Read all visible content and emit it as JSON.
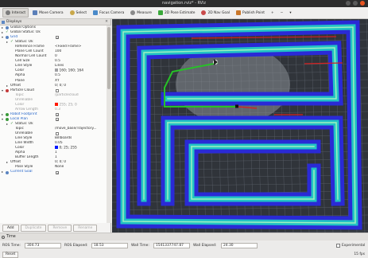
{
  "window": {
    "title": "navigation.rviz* - RViz"
  },
  "toolbar": {
    "tools": [
      {
        "label": "Interact",
        "icon": "interact-icon",
        "active": true
      },
      {
        "label": "Move Camera",
        "icon": "move-camera-icon",
        "active": false
      },
      {
        "label": "Select",
        "icon": "select-icon",
        "active": false
      },
      {
        "label": "Focus Camera",
        "icon": "focus-camera-icon",
        "active": false
      },
      {
        "label": "Measure",
        "icon": "measure-icon",
        "active": false
      },
      {
        "label": "2D Pose Estimate",
        "icon": "pose-estimate-icon",
        "active": false
      },
      {
        "label": "2D Nav Goal",
        "icon": "nav-goal-icon",
        "active": false
      },
      {
        "label": "Publish Point",
        "icon": "publish-point-icon",
        "active": false
      }
    ],
    "extra_plus": "+",
    "extra_minus": "−",
    "extra_arrow": "▾"
  },
  "displays": {
    "title": "Displays",
    "close": "✕",
    "rows": [
      {
        "key": "Global Options",
        "indent": 0,
        "arrow": "▸",
        "icon_color": "#5a84c0"
      },
      {
        "key": "Global Status: Ok",
        "indent": 0,
        "arrow": "▸",
        "check": "✓"
      },
      {
        "key": "Grid",
        "indent": 0,
        "arrow": "▾",
        "icon_color": "#5a84c0",
        "checkbox": "✓",
        "blue": true
      },
      {
        "key": "Status: Ok",
        "indent": 1,
        "arrow": "▸",
        "check": "✓"
      },
      {
        "key": "Reference Frame",
        "indent": 2,
        "value": "<Fixed Frame>"
      },
      {
        "key": "Plane Cell Count",
        "indent": 2,
        "value": "100"
      },
      {
        "key": "Normal Cell Count",
        "indent": 2,
        "value": "0"
      },
      {
        "key": "Cell Size",
        "indent": 2,
        "value": "0.5"
      },
      {
        "key": "Line Style",
        "indent": 2,
        "value": "Lines"
      },
      {
        "key": "Color",
        "indent": 2,
        "value": "160; 160; 164",
        "swatch": "#a0a0a4"
      },
      {
        "key": "Alpha",
        "indent": 2,
        "value": "0.5"
      },
      {
        "key": "Plane",
        "indent": 2,
        "value": "XY"
      },
      {
        "key": "Offset",
        "indent": 1,
        "arrow": "▸",
        "value": "0; 0; 0"
      },
      {
        "key": "Particle Cloud",
        "indent": 0,
        "arrow": "▾",
        "icon_color": "#c43a3a",
        "checkbox": ""
      },
      {
        "key": "Topic",
        "indent": 2,
        "value": "/particlecloud",
        "grey": true
      },
      {
        "key": "Unreliable",
        "indent": 2,
        "value": "",
        "grey": true
      },
      {
        "key": "Color",
        "indent": 2,
        "value": "255; 25; 0",
        "grey": true,
        "swatch": "#ff1900"
      },
      {
        "key": "Arrow Length",
        "indent": 2,
        "value": "0.3",
        "grey": true
      },
      {
        "key": "Robot Footprint",
        "indent": 0,
        "arrow": "▸",
        "icon_color": "#3a9a3a",
        "checkbox": "✓",
        "blue": true
      },
      {
        "key": "Local Plan",
        "indent": 0,
        "arrow": "▾",
        "icon_color": "#3a9a3a",
        "checkbox": "✓",
        "blue": true
      },
      {
        "key": "Status: Ok",
        "indent": 1,
        "arrow": "▸",
        "check": "✓"
      },
      {
        "key": "Topic",
        "indent": 2,
        "value": "/move_base/Trajectory..."
      },
      {
        "key": "Unreliable",
        "indent": 2,
        "value": "",
        "cbval": true
      },
      {
        "key": "Line Style",
        "indent": 2,
        "value": "Billboards"
      },
      {
        "key": "Line Width",
        "indent": 2,
        "value": "0.05"
      },
      {
        "key": "Color",
        "indent": 2,
        "value": "0; 25; 255",
        "swatch": "#0019ff"
      },
      {
        "key": "Alpha",
        "indent": 2,
        "value": "1"
      },
      {
        "key": "Buffer Length",
        "indent": 2,
        "value": "1"
      },
      {
        "key": "Offset",
        "indent": 1,
        "arrow": "▸",
        "value": "0; 0; 0"
      },
      {
        "key": "Pose Style",
        "indent": 2,
        "value": "None"
      },
      {
        "key": "Current Goal",
        "indent": 0,
        "arrow": "▸",
        "icon_color": "#5a84c0",
        "checkbox": "✓",
        "blue": true
      }
    ],
    "buttons": {
      "add": "Add",
      "duplicate": "Duplicate",
      "remove": "Remove",
      "rename": "Rename"
    }
  },
  "view": {
    "name": "3d-map-view",
    "colors": {
      "background": "#30343a",
      "grid": "#808894",
      "costmap_outer": "#2a2ad6",
      "costmap_inner": "#22c4c4",
      "wall": "#9ff0c0",
      "global_plan": "#27c227",
      "local_plan": "#d42020"
    }
  },
  "time": {
    "title": "Time",
    "ros_time_label": "ROS Time:",
    "ros_time": "304.73",
    "ros_elapsed_label": "ROS Elapsed:",
    "ros_elapsed": "18.53",
    "wall_time_label": "Wall Time:",
    "wall_time": "1541337747.87",
    "wall_elapsed_label": "Wall Elapsed:",
    "wall_elapsed": "24.30",
    "experimental_label": "Experimental"
  },
  "status": {
    "reset": "Reset",
    "fps": "15 fps"
  }
}
